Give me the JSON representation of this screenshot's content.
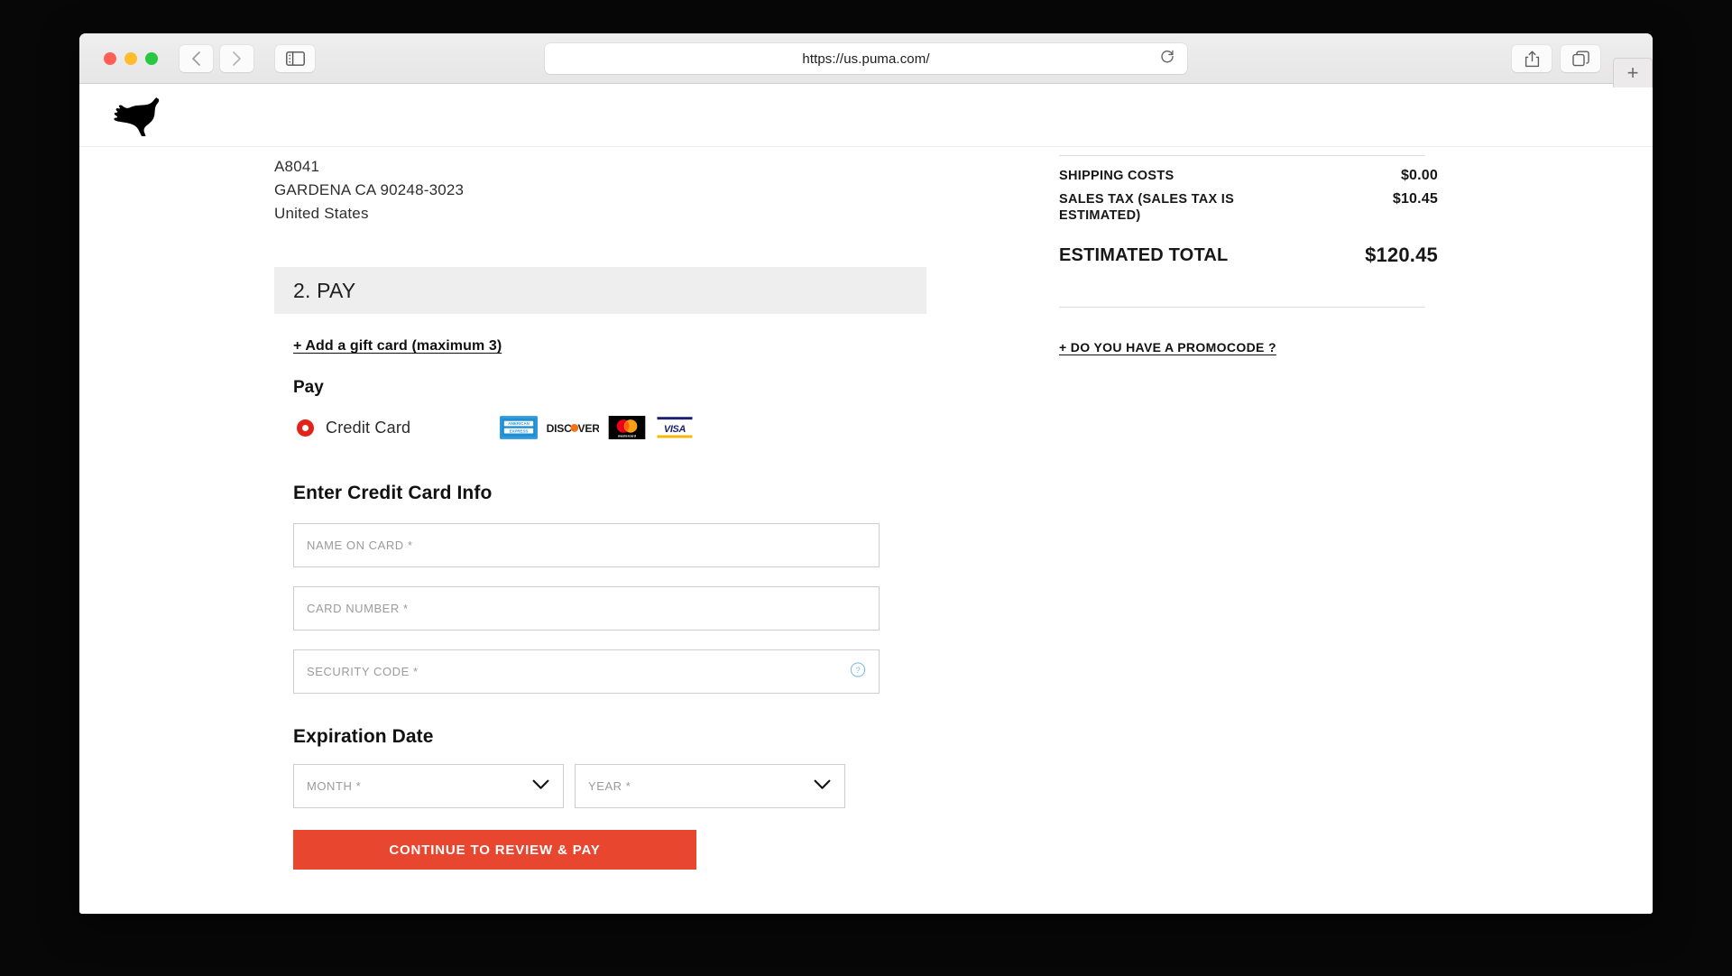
{
  "browser": {
    "url": "https://us.puma.com/",
    "back_label": "Back",
    "forward_label": "Forward",
    "sidebar_label": "Sidebar",
    "reload_label": "Reload",
    "share_label": "Share",
    "tabs_label": "Show Tab Overview",
    "new_tab_label": "+"
  },
  "site": {
    "brand": "PUMA"
  },
  "shipping_address": {
    "line1": "A8041",
    "line2": "GARDENA CA 90248-3023",
    "line3": "United States"
  },
  "pay_section": {
    "header": "2. PAY",
    "gift_card_link": "+ Add a gift card (maximum 3)",
    "pay_label": "Pay",
    "method": {
      "selected": true,
      "label": "Credit Card"
    },
    "accepted_cards": [
      "american-express",
      "discover",
      "mastercard",
      "visa"
    ],
    "form": {
      "title": "Enter Credit Card Info",
      "name_on_card": {
        "placeholder": "NAME ON CARD *",
        "value": ""
      },
      "card_number": {
        "placeholder": "CARD NUMBER *",
        "value": ""
      },
      "security_code": {
        "placeholder": "SECURITY CODE *",
        "value": "",
        "help_icon": "question-circle-icon"
      },
      "expiration_title": "Expiration Date",
      "month": {
        "placeholder": "MONTH *",
        "value": ""
      },
      "year": {
        "placeholder": "YEAR *",
        "value": ""
      },
      "submit_label": "CONTINUE TO REVIEW & PAY"
    }
  },
  "order_summary": {
    "rows": [
      {
        "label": "SHIPPING COSTS",
        "value": "$0.00"
      },
      {
        "label": "SALES TAX (SALES TAX IS ESTIMATED)",
        "value": "$10.45"
      }
    ],
    "total": {
      "label": "ESTIMATED TOTAL",
      "value": "$120.45"
    },
    "promocode_link": "+ DO YOU HAVE A PROMOCODE ?"
  },
  "colors": {
    "brand_red": "#e8462f",
    "radio_red": "#e2231a",
    "section_grey": "#eeeeee",
    "border_grey": "#cdcdcd"
  }
}
